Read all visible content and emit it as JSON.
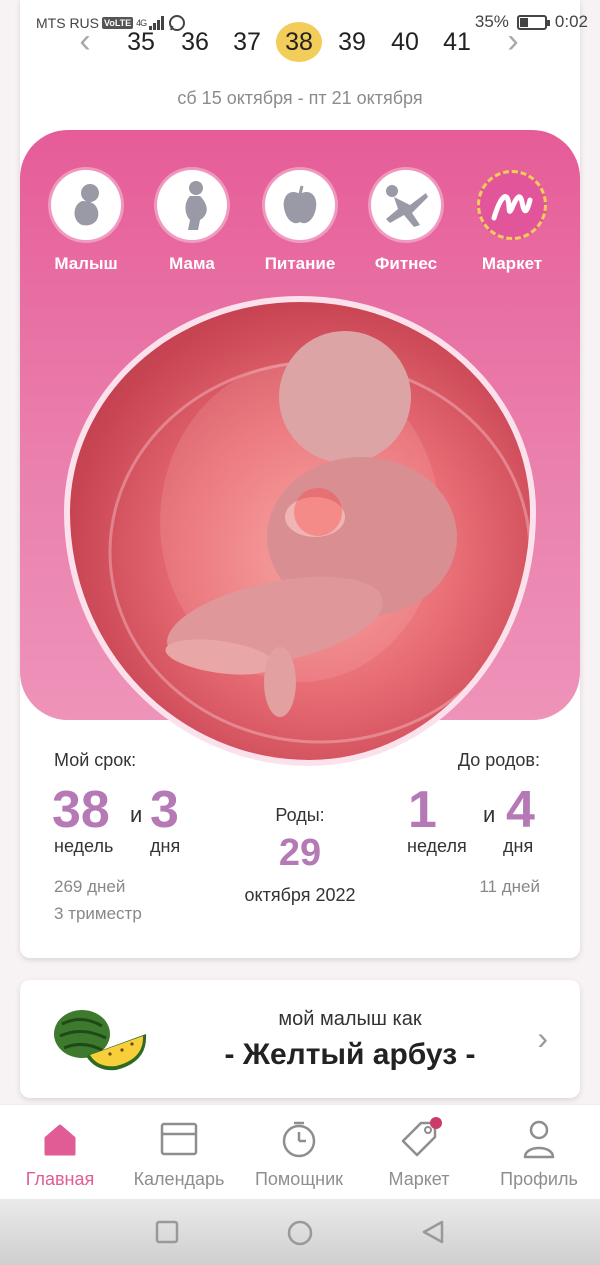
{
  "status_bar": {
    "carrier": "MTS RUS",
    "volte": "VoLTE",
    "network": "4G",
    "battery_text": "35%",
    "battery_level": 0.35,
    "time": "0:02"
  },
  "week_selector": {
    "weeks": [
      "35",
      "36",
      "37",
      "38",
      "39",
      "40",
      "41"
    ],
    "active_week": "38",
    "date_range": "сб 15 октября - пт 21 октября"
  },
  "categories": [
    {
      "label": "Малыш",
      "icon": "baby-icon"
    },
    {
      "label": "Мама",
      "icon": "pregnant-mother-icon"
    },
    {
      "label": "Питание",
      "icon": "apple-icon"
    },
    {
      "label": "Фитнес",
      "icon": "yoga-icon"
    },
    {
      "label": "Маркет",
      "icon": "market-logo-icon"
    }
  ],
  "stats": {
    "term_title": "Мой срок:",
    "weeks_value": "38",
    "and": "и",
    "days_value": "3",
    "weeks_unit": "недель",
    "days_unit": "дня",
    "total_days": "269 дней",
    "trimester": "3 триместр",
    "births_label": "Роды:",
    "births_day": "29",
    "births_month_year": "октября 2022",
    "left_title": "До родов:",
    "left_weeks_value": "1",
    "left_days_value": "4",
    "left_weeks_unit": "неделя",
    "left_days_unit": "дня",
    "left_total_days": "11 дней"
  },
  "baby_compare": {
    "prefix": "мой малыш как",
    "fruit": "- Желтый арбуз -",
    "image_icon": "yellow-watermelon-icon"
  },
  "bottom_nav": [
    {
      "label": "Главная",
      "icon": "home-icon",
      "active": true
    },
    {
      "label": "Календарь",
      "icon": "calendar-icon",
      "active": false
    },
    {
      "label": "Помощник",
      "icon": "timer-icon",
      "active": false
    },
    {
      "label": "Маркет",
      "icon": "price-tag-icon",
      "active": false,
      "badge": true
    },
    {
      "label": "Профиль",
      "icon": "person-icon",
      "active": false
    }
  ],
  "colors": {
    "accent_pink": "#e15b94",
    "hero_gradient_top": "#e65c98",
    "number_purple": "#b57ab6",
    "active_week_yellow": "#f3cd59"
  }
}
